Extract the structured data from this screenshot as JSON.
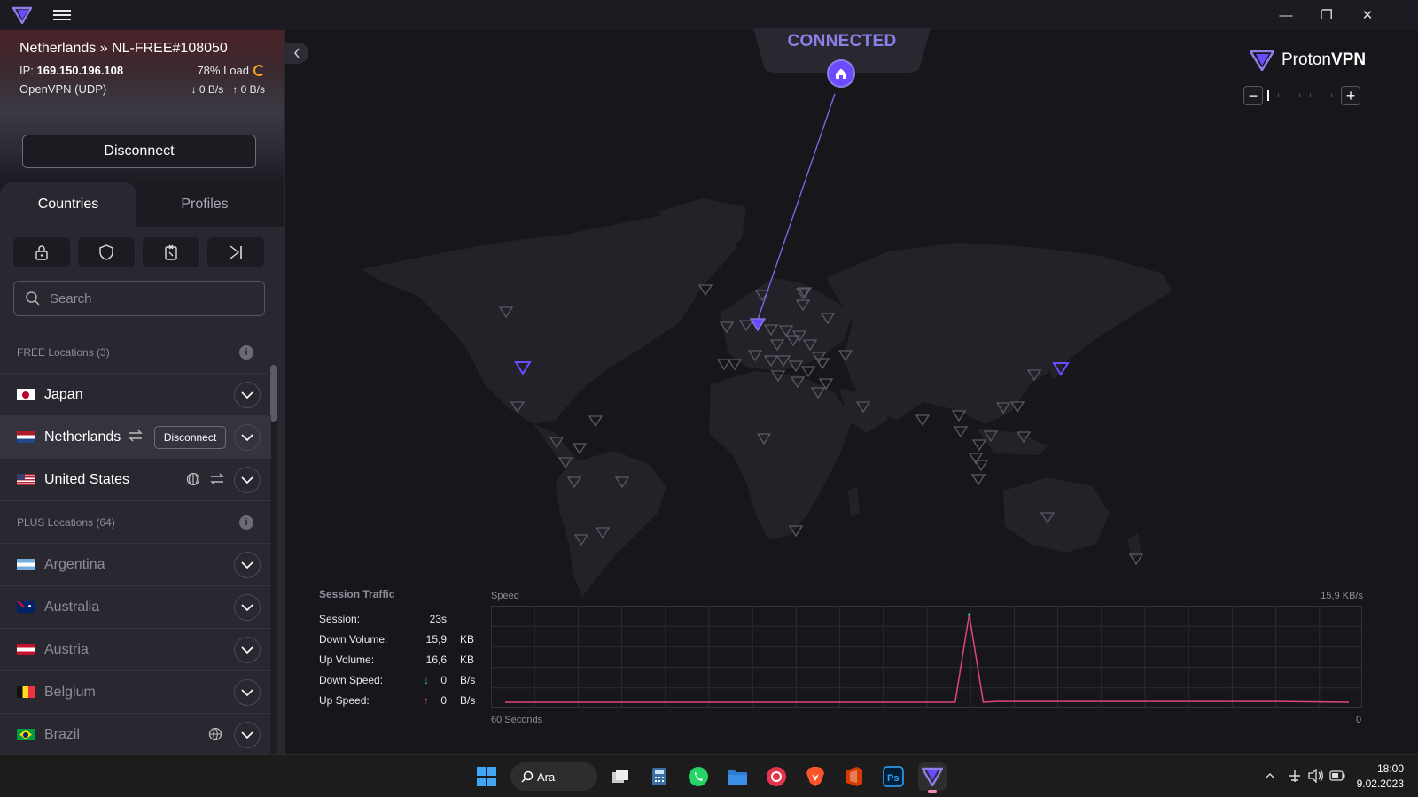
{
  "app": {
    "window_controls": {
      "minimize": "—",
      "restore": "❐",
      "close": "✕"
    }
  },
  "connection": {
    "server": "Netherlands » NL-FREE#108050",
    "ip_label": "IP:",
    "ip": "169.150.196.108",
    "load": "78% Load",
    "protocol": "OpenVPN (UDP)",
    "down_rate": "0 B/s",
    "up_rate": "0 B/s",
    "disconnect_label": "Disconnect"
  },
  "tabs": {
    "countries": "Countries",
    "profiles": "Profiles"
  },
  "search": {
    "placeholder": "Search"
  },
  "list": {
    "free_header": "FREE Locations (3)",
    "plus_header": "PLUS Locations (64)",
    "free": [
      {
        "name": "Japan"
      },
      {
        "name": "Netherlands",
        "action": "Disconnect"
      },
      {
        "name": "United States"
      }
    ],
    "plus": [
      {
        "name": "Argentina"
      },
      {
        "name": "Australia"
      },
      {
        "name": "Austria"
      },
      {
        "name": "Belgium"
      },
      {
        "name": "Brazil"
      }
    ]
  },
  "map": {
    "status": "CONNECTED",
    "brand": {
      "proton": "Proton",
      "vpn": "VPN"
    },
    "zoom_out": "−",
    "zoom_in": "+"
  },
  "traffic": {
    "title": "Session Traffic",
    "rows": [
      {
        "label": "Session:",
        "value": "23s",
        "unit": ""
      },
      {
        "label": "Down Volume:",
        "value": "15,9",
        "unit": "KB"
      },
      {
        "label": "Up Volume:",
        "value": "16,6",
        "unit": "KB"
      },
      {
        "label": "Down Speed:",
        "value": "0",
        "unit": "B/s"
      },
      {
        "label": "Up Speed:",
        "value": "0",
        "unit": "B/s"
      }
    ],
    "speed_label": "Speed",
    "speed_max": "15,9  KB/s",
    "x_left": "60 Seconds",
    "x_right": "0"
  },
  "chart_data": {
    "type": "line",
    "title": "",
    "xlabel": "",
    "ylabel": "Speed",
    "x": [
      60,
      28,
      27,
      26,
      25,
      20,
      15,
      10,
      5,
      0
    ],
    "ylim": [
      0,
      15.9
    ],
    "series": [
      {
        "values": [
          0,
          0,
          15.9,
          0,
          0.15,
          0.15,
          0.15,
          0.15,
          0.15,
          0
        ]
      }
    ],
    "grid": true
  },
  "taskbar": {
    "search": "Ara",
    "time": "18:00",
    "date": "9.02.2023"
  },
  "colors": {
    "accent": "#6d4aff",
    "connected": "#8b7fe8",
    "down_line": "#e0457b",
    "up_line": "#2dbd7e"
  }
}
